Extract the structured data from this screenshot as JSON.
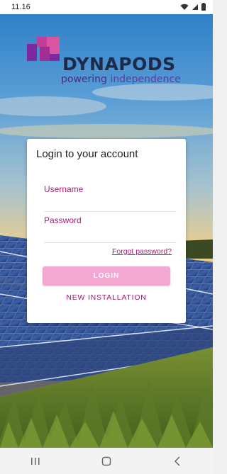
{
  "status_bar": {
    "time": "11.16"
  },
  "brand": {
    "name": "DYNAPODS",
    "tagline_part1": "powering",
    "tagline_part2": " independence"
  },
  "login_card": {
    "title": "Login to your account",
    "username_label": "Username",
    "password_label": "Password",
    "forgot_password": "Forgot password?",
    "login_button": "LOGIN",
    "new_installation": "NEW INSTALLATION"
  },
  "nav_bar": {
    "icons": [
      "recent-apps-icon",
      "home-icon",
      "back-icon"
    ]
  },
  "colors": {
    "accent": "#b3167b",
    "button": "#f2a8d0",
    "brand_dark": "#1e2a49",
    "brand_purple": "#5f3aa0"
  }
}
